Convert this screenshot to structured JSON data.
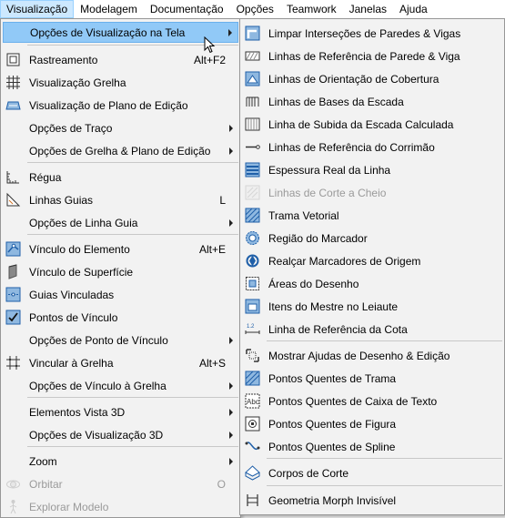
{
  "menubar": [
    "Visualização",
    "Modelagem",
    "Documentação",
    "Opções",
    "Teamwork",
    "Janelas",
    "Ajuda"
  ],
  "main_menu": [
    {
      "label": "Opções de Visualização na Tela",
      "arrow": true,
      "icon": "none",
      "selected": true
    },
    {
      "label": "Rastreamento",
      "shortcut": "Alt+F2",
      "icon": "tracker-icon"
    },
    {
      "label": "Visualização Grelha",
      "icon": "grid-icon"
    },
    {
      "label": "Visualização de Plano de Edição",
      "icon": "editing-plane-icon"
    },
    {
      "label": "Opções de Traço",
      "arrow": true,
      "icon": "none"
    },
    {
      "label": "Opções de Grelha & Plano de Edição",
      "arrow": true,
      "icon": "none"
    },
    {
      "label": "Régua",
      "icon": "ruler-icon"
    },
    {
      "label": "Linhas Guias",
      "shortcut": "L",
      "icon": "guide-lines-icon"
    },
    {
      "label": "Opções de Linha Guia",
      "arrow": true,
      "icon": "none"
    },
    {
      "label": "Vínculo do Elemento",
      "shortcut": "Alt+E",
      "icon": "element-snap-icon"
    },
    {
      "label": "Vínculo de Superfície",
      "icon": "surface-snap-icon"
    },
    {
      "label": "Guias Vinculadas",
      "icon": "snap-guides-icon"
    },
    {
      "label": "Pontos de Vínculo",
      "icon": "snap-points-icon"
    },
    {
      "label": "Opções de Ponto de Vínculo",
      "arrow": true,
      "icon": "none"
    },
    {
      "label": "Vincular à Grelha",
      "shortcut": "Alt+S",
      "icon": "snap-grid-icon"
    },
    {
      "label": "Opções de Vínculo à Grelha",
      "arrow": true,
      "icon": "none"
    },
    {
      "label": "Elementos Vista 3D",
      "arrow": true,
      "icon": "none"
    },
    {
      "label": "Opções de Visualização 3D",
      "arrow": true,
      "icon": "none"
    },
    {
      "label": "Zoom",
      "arrow": true,
      "icon": "none"
    },
    {
      "label": "Orbitar",
      "shortcut": "O",
      "icon": "orbit-icon",
      "disabled": true
    },
    {
      "label": "Explorar Modelo",
      "icon": "explore-model-icon",
      "disabled": true
    }
  ],
  "sub_menu": [
    {
      "label": "Limpar Interseções  de Paredes & Vigas",
      "icon": "clean-intersections-icon"
    },
    {
      "label": "Linhas de Referência de Parede & Viga",
      "icon": "reference-lines-icon"
    },
    {
      "label": "Linhas de Orientação de Cobertura",
      "icon": "roof-pivot-lines-icon"
    },
    {
      "label": "Linhas de Bases da Escada",
      "icon": "stair-baselines-icon"
    },
    {
      "label": "Linha de Subida da Escada Calculada",
      "icon": "stair-walking-line-icon"
    },
    {
      "label": "Linhas de Referência do Corrimão",
      "icon": "railing-reference-icon"
    },
    {
      "label": "Espessura Real da Linha",
      "icon": "true-line-weight-icon"
    },
    {
      "label": "Linhas de Corte a Cheio",
      "icon": "bold-cut-lines-icon",
      "disabled": true
    },
    {
      "label": "Trama Vetorial",
      "icon": "vectorial-hatching-icon"
    },
    {
      "label": "Região do Marcador",
      "icon": "marker-region-icon"
    },
    {
      "label": "Realçar Marcadores de Origem",
      "icon": "source-markers-icon"
    },
    {
      "label": "Áreas do Desenho",
      "icon": "drawing-areas-icon"
    },
    {
      "label": "Itens do Mestre no Leiaute",
      "icon": "master-items-icon"
    },
    {
      "label": "Linha de Referência da Cota",
      "icon": "dimension-reference-icon"
    },
    {
      "label": "Mostrar Ajudas de Desenho & Edição",
      "icon": "drafting-aids-icon"
    },
    {
      "label": "Pontos Quentes de Trama",
      "icon": "fill-hotspots-icon"
    },
    {
      "label": "Pontos Quentes de Caixa de Texto",
      "icon": "textbox-hotspots-icon"
    },
    {
      "label": "Pontos Quentes de Figura",
      "icon": "figure-hotspots-icon"
    },
    {
      "label": "Pontos Quentes de Spline",
      "icon": "spline-hotspots-icon"
    },
    {
      "label": "Corpos de Corte",
      "icon": "cutting-bodies-icon"
    },
    {
      "label": "Geometria Morph Invisível",
      "icon": "hidden-morph-icon"
    }
  ]
}
